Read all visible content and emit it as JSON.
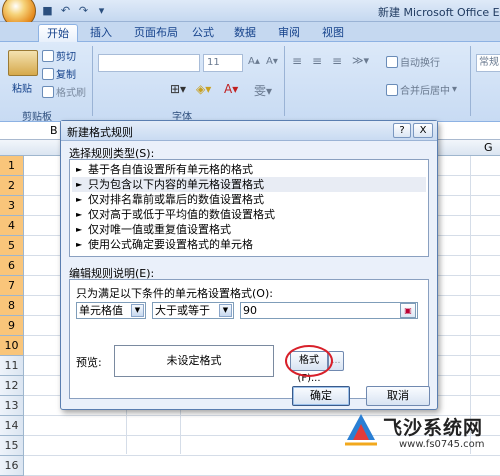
{
  "window": {
    "title": "新建 Microsoft Office Exce"
  },
  "ribbon_tabs": [
    "开始",
    "插入",
    "页面布局",
    "公式",
    "数据",
    "审阅",
    "视图"
  ],
  "clipboard": {
    "paste": "粘贴",
    "cut": "剪切",
    "copy": "复制",
    "format_painter": "格式刷",
    "group": "剪贴板"
  },
  "font": {
    "size": "11",
    "group": "字体"
  },
  "alignment": {
    "wrap_text": "自动换行",
    "merge_center": "合并后居中"
  },
  "number": {
    "format": "常规"
  },
  "sheet": {
    "name_box": "B",
    "col_g": "G",
    "rows": [
      "1",
      "2",
      "3",
      "4",
      "5",
      "6",
      "7",
      "8",
      "9",
      "10",
      "11",
      "12",
      "13",
      "14",
      "15",
      "16"
    ]
  },
  "dialog": {
    "title": "新建格式规则",
    "help": "?",
    "close": "X",
    "rule_type_label": "选择规则类型(S):",
    "rule_types": [
      "基于各自值设置所有单元格的格式",
      "只为包含以下内容的单元格设置格式",
      "仅对排名靠前或靠后的数值设置格式",
      "仅对高于或低于平均值的数值设置格式",
      "仅对唯一值或重复值设置格式",
      "使用公式确定要设置格式的单元格"
    ],
    "selected_rule_index": 1,
    "rule_desc_label": "编辑规则说明(E):",
    "condition_label": "只为满足以下条件的单元格设置格式(O):",
    "condition_field": "单元格值",
    "condition_operator": "大于或等于",
    "condition_value": "90",
    "preview_label": "预览:",
    "preview_text": "未设定格式",
    "format_button": "格式(F)...",
    "ok_button": "确定",
    "cancel_button": "取消"
  },
  "watermark": {
    "site_name": "飞沙系统网",
    "url": "www.fs0745.com"
  },
  "colors": {
    "highlight_rows": "#f9c57a",
    "annotation_red": "#d8202a",
    "ribbon_blue": "#c5d8f0"
  }
}
